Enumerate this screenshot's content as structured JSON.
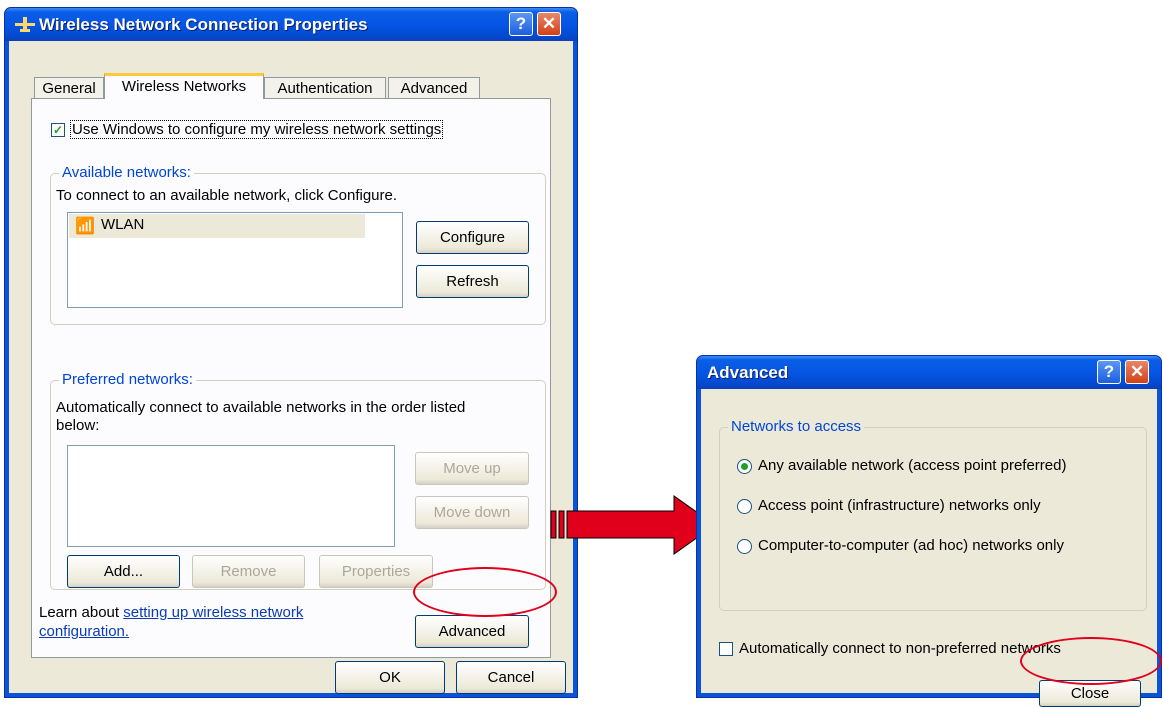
{
  "main_dialog": {
    "title": "Wireless Network Connection Properties",
    "tabs": [
      "General",
      "Wireless Networks",
      "Authentication",
      "Advanced"
    ],
    "active_tab": "Wireless Networks",
    "use_windows_checkbox": {
      "label": "Use Windows to configure my wireless network settings",
      "checked": true
    },
    "available": {
      "legend": "Available networks:",
      "hint": "To connect to an available network, click Configure.",
      "networks": [
        "WLAN"
      ],
      "configure_label": "Configure",
      "refresh_label": "Refresh"
    },
    "preferred": {
      "legend": "Preferred networks:",
      "hint_line1": "Automatically connect to available networks in the order listed",
      "hint_line2": "below:",
      "move_up_label": "Move up",
      "move_down_label": "Move down",
      "add_label": "Add...",
      "remove_label": "Remove",
      "properties_label": "Properties"
    },
    "learn_prefix": "Learn about ",
    "learn_link_line1": "setting up wireless network",
    "learn_link_line2": "configuration.",
    "advanced_label": "Advanced",
    "ok_label": "OK",
    "cancel_label": "Cancel"
  },
  "advanced_dialog": {
    "title": "Advanced",
    "group_legend": "Networks to access",
    "options": [
      {
        "label": "Any available network (access point preferred)",
        "selected": true
      },
      {
        "label": "Access point (infrastructure) networks only",
        "selected": false
      },
      {
        "label": "Computer-to-computer (ad hoc) networks only",
        "selected": false
      }
    ],
    "auto_connect_label": "Automatically connect to non-preferred networks",
    "auto_connect_checked": false,
    "close_label": "Close"
  },
  "colors": {
    "annotation": "#e0001c",
    "arrow": "#e0001c"
  }
}
